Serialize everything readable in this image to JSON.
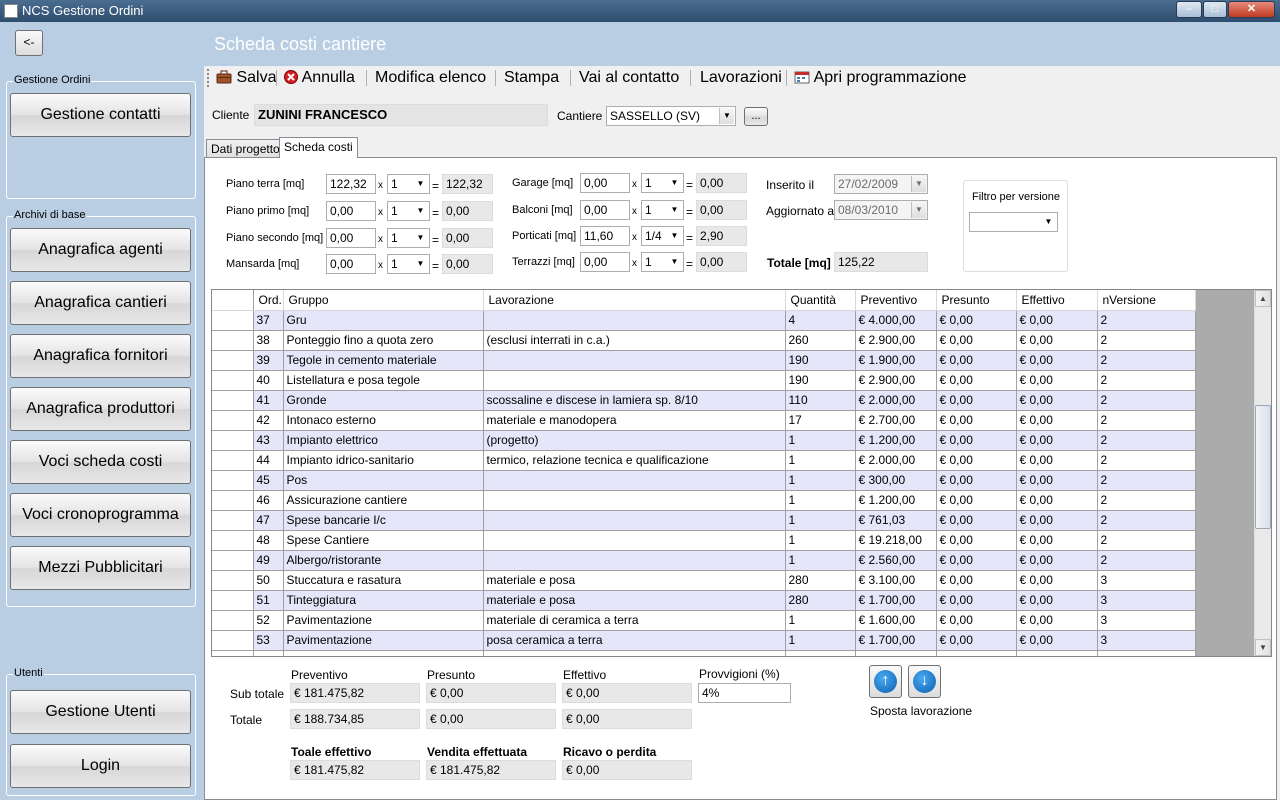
{
  "window": {
    "title": "NCS Gestione Ordini",
    "min": "–",
    "max": "□",
    "close": "✕"
  },
  "back_label": "<-",
  "page_title": "Scheda costi cantiere",
  "sidebar": {
    "group1_title": "Gestione Ordini",
    "contatti": "Gestione contatti",
    "group2_title": "Archivi di base",
    "items": [
      "Anagrafica agenti",
      "Anagrafica cantieri",
      "Anagrafica fornitori",
      "Anagrafica produttori",
      "Voci scheda costi",
      "Voci cronoprogramma",
      "Mezzi Pubblicitari"
    ],
    "group3_title": "Utenti",
    "utenti": "Gestione Utenti",
    "login": "Login"
  },
  "toolbar": {
    "salva": "Salva",
    "annulla": "Annulla",
    "modifica": "Modifica elenco",
    "stampa": "Stampa",
    "vai": "Vai al contatto",
    "lavorazioni": "Lavorazioni",
    "apri": "Apri programmazione"
  },
  "cliente": {
    "label": "Cliente",
    "value": "ZUNINI FRANCESCO"
  },
  "cantiere": {
    "label": "Cantiere",
    "value": "SASSELLO (SV)",
    "btn": "..."
  },
  "tabs": [
    "Dati progetto",
    "Scheda costi"
  ],
  "areas": {
    "x": "x",
    "eq": "=",
    "rows": [
      {
        "label": "Piano terra [mq]",
        "mq": "122,32",
        "mult": "1",
        "res": "122,32"
      },
      {
        "label": "Piano primo [mq]",
        "mq": "0,00",
        "mult": "1",
        "res": "0,00"
      },
      {
        "label": "Piano secondo [mq]",
        "mq": "0,00",
        "mult": "1",
        "res": "0,00"
      },
      {
        "label": "Mansarda [mq]",
        "mq": "0,00",
        "mult": "1",
        "res": "0,00"
      },
      {
        "label": "Garage [mq]",
        "mq": "0,00",
        "mult": "1",
        "res": "0,00"
      },
      {
        "label": "Balconi [mq]",
        "mq": "0,00",
        "mult": "1",
        "res": "0,00"
      },
      {
        "label": "Porticati [mq]",
        "mq": "11,60",
        "mult": "1/4",
        "res": "2,90"
      },
      {
        "label": "Terrazzi [mq]",
        "mq": "0,00",
        "mult": "1",
        "res": "0,00"
      }
    ]
  },
  "dates": {
    "inserito_label": "Inserito il",
    "inserito": "27/02/2009",
    "aggiornato_label": "Aggiornato al",
    "aggiornato": "08/03/2010",
    "totale_label": "Totale [mq]",
    "totale": "125,22"
  },
  "filtro": {
    "label": "Filtro per versione",
    "value": ""
  },
  "table": {
    "columns": [
      "Ord.",
      "Gruppo",
      "Lavorazione",
      "Quantità",
      "Preventivo",
      "Presunto",
      "Effettivo",
      "nVersione"
    ],
    "rows": [
      [
        "37",
        "Gru",
        "",
        "4",
        "€ 4.000,00",
        "€ 0,00",
        "€ 0,00",
        "2"
      ],
      [
        "38",
        "Ponteggio fino a quota zero",
        "(esclusi interrati in c.a.)",
        "260",
        "€ 2.900,00",
        "€ 0,00",
        "€ 0,00",
        "2"
      ],
      [
        "39",
        "Tegole in cemento materiale",
        "",
        "190",
        "€ 1.900,00",
        "€ 0,00",
        "€ 0,00",
        "2"
      ],
      [
        "40",
        "Listellatura e posa tegole",
        "",
        "190",
        "€ 2.900,00",
        "€ 0,00",
        "€ 0,00",
        "2"
      ],
      [
        "41",
        "Gronde",
        "scossaline e discese in lamiera sp. 8/10",
        "110",
        "€ 2.000,00",
        "€ 0,00",
        "€ 0,00",
        "2"
      ],
      [
        "42",
        "Intonaco esterno",
        "materiale e manodopera",
        "17",
        "€ 2.700,00",
        "€ 0,00",
        "€ 0,00",
        "2"
      ],
      [
        "43",
        "Impianto elettrico",
        "(progetto)",
        "1",
        "€ 1.200,00",
        "€ 0,00",
        "€ 0,00",
        "2"
      ],
      [
        "44",
        "Impianto idrico-sanitario",
        "termico, relazione tecnica e qualificazione",
        "1",
        "€ 2.000,00",
        "€ 0,00",
        "€ 0,00",
        "2"
      ],
      [
        "45",
        "Pos",
        "",
        "1",
        "€ 300,00",
        "€ 0,00",
        "€ 0,00",
        "2"
      ],
      [
        "46",
        "Assicurazione cantiere",
        "",
        "1",
        "€ 1.200,00",
        "€ 0,00",
        "€ 0,00",
        "2"
      ],
      [
        "47",
        "Spese bancarie I/c",
        "",
        "1",
        "€ 761,03",
        "€ 0,00",
        "€ 0,00",
        "2"
      ],
      [
        "48",
        "Spese Cantiere",
        "",
        "1",
        "€ 19.218,00",
        "€ 0,00",
        "€ 0,00",
        "2"
      ],
      [
        "49",
        "Albergo/ristorante",
        "",
        "1",
        "€ 2.560,00",
        "€ 0,00",
        "€ 0,00",
        "2"
      ],
      [
        "50",
        "Stuccatura e rasatura",
        "materiale e posa",
        "280",
        "€ 3.100,00",
        "€ 0,00",
        "€ 0,00",
        "3"
      ],
      [
        "51",
        "Tinteggiatura",
        "materiale e posa",
        "280",
        "€ 1.700,00",
        "€ 0,00",
        "€ 0,00",
        "3"
      ],
      [
        "52",
        "Pavimentazione",
        "materiale di ceramica a terra",
        "1",
        "€ 1.600,00",
        "€ 0,00",
        "€ 0,00",
        "3"
      ],
      [
        "53",
        "Pavimentazione",
        "posa ceramica a terra",
        "1",
        "€ 1.700,00",
        "€ 0,00",
        "€ 0,00",
        "3"
      ]
    ]
  },
  "totals": {
    "hdr_prev": "Preventivo",
    "hdr_pres": "Presunto",
    "hdr_eff": "Effettivo",
    "hdr_prov": "Provvigioni (%)",
    "sub_label": "Sub totale",
    "sub_prev": "€ 181.475,82",
    "sub_pres": "€ 0,00",
    "sub_eff": "€ 0,00",
    "prov": "4%",
    "tot_label": "Totale",
    "tot_prev": "€ 188.734,85",
    "tot_pres": "€ 0,00",
    "tot_eff": "€ 0,00",
    "h_eff": "Toale effettivo",
    "h_vend": "Vendita effettuata",
    "h_ric": "Ricavo o perdita",
    "v_eff": "€ 181.475,82",
    "v_vend": "€ 181.475,82",
    "v_ric": "€ 0,00",
    "sposta": "Sposta lavorazione"
  }
}
